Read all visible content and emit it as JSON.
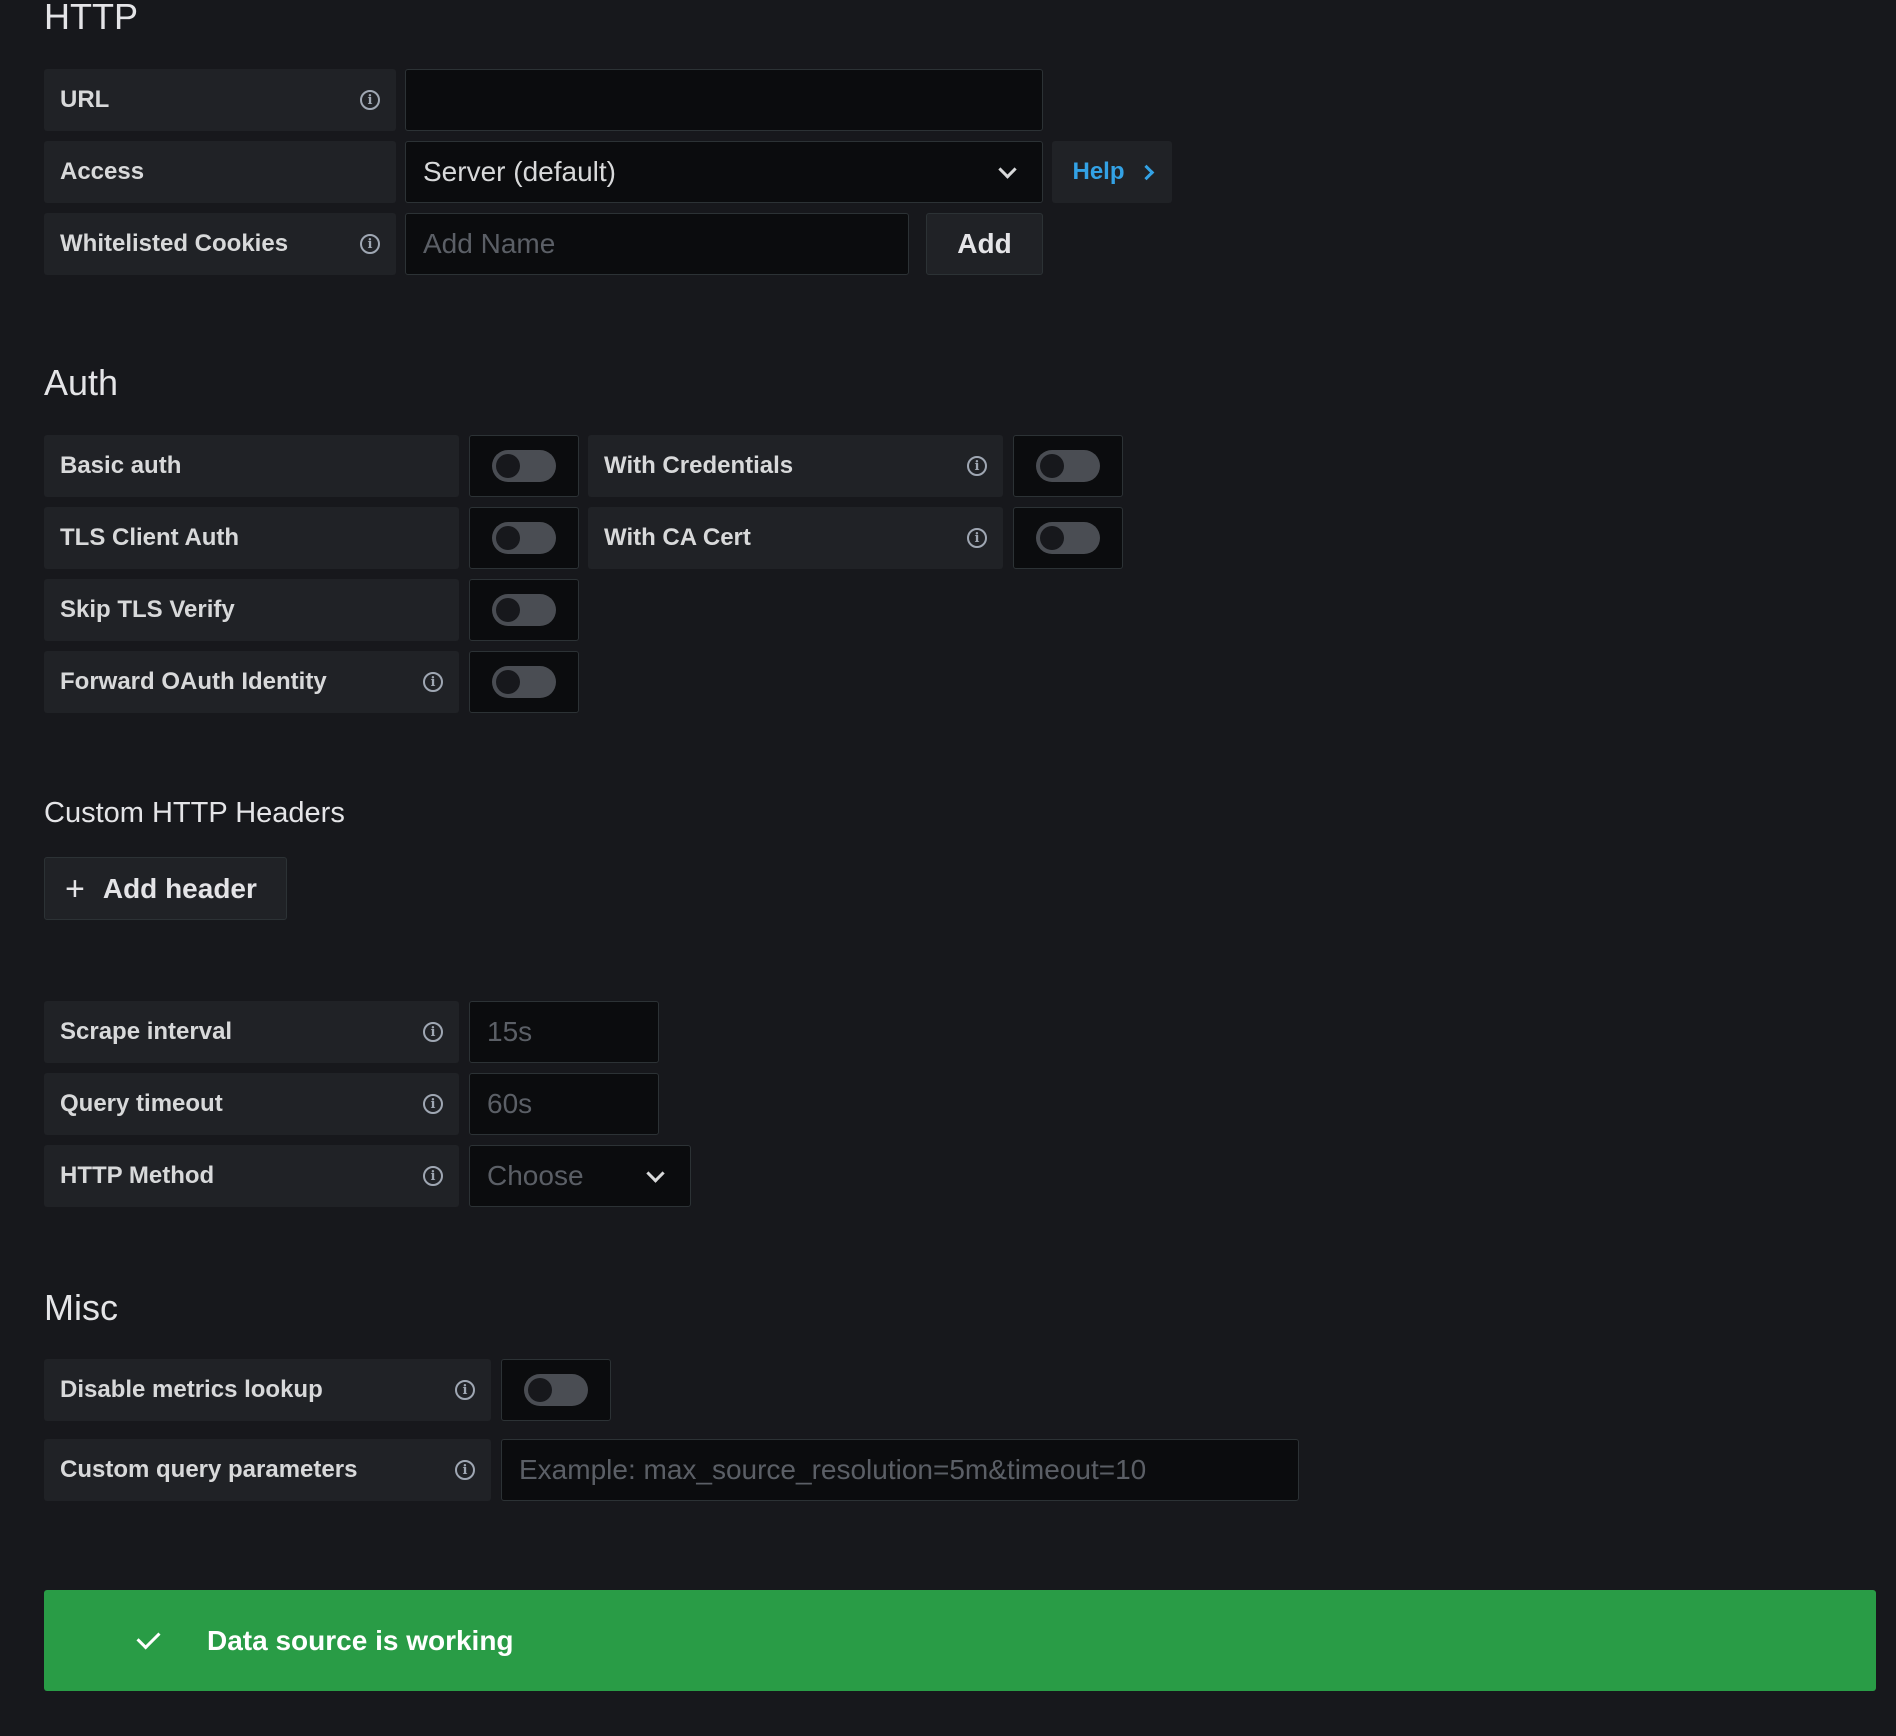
{
  "http": {
    "title": "HTTP",
    "url_label": "URL",
    "url_value": "",
    "access_label": "Access",
    "access_value": "Server (default)",
    "help_label": "Help",
    "cookies_label": "Whitelisted Cookies",
    "cookies_placeholder": "Add Name",
    "add_label": "Add"
  },
  "auth": {
    "title": "Auth",
    "basic_auth": "Basic auth",
    "with_credentials": "With Credentials",
    "tls_client_auth": "TLS Client Auth",
    "with_ca_cert": "With CA Cert",
    "skip_tls_verify": "Skip TLS Verify",
    "forward_oauth": "Forward OAuth Identity",
    "toggles": {
      "basic_auth": false,
      "with_credentials": false,
      "tls_client_auth": false,
      "with_ca_cert": false,
      "skip_tls_verify": false,
      "forward_oauth": false
    }
  },
  "headers": {
    "title": "Custom HTTP Headers",
    "add_header_label": "Add header"
  },
  "prometheus": {
    "scrape_interval_label": "Scrape interval",
    "scrape_interval_placeholder": "15s",
    "query_timeout_label": "Query timeout",
    "query_timeout_placeholder": "60s",
    "http_method_label": "HTTP Method",
    "http_method_placeholder": "Choose"
  },
  "misc": {
    "title": "Misc",
    "disable_metrics_label": "Disable metrics lookup",
    "disable_metrics_toggle": false,
    "custom_query_label": "Custom query parameters",
    "custom_query_placeholder": "Example: max_source_resolution=5m&timeout=10"
  },
  "status": {
    "message": "Data source is working"
  },
  "colors": {
    "background": "#17181c",
    "label_bg": "#202226",
    "input_bg": "#0b0c0e",
    "link": "#33a2e5",
    "success": "#299c46"
  }
}
